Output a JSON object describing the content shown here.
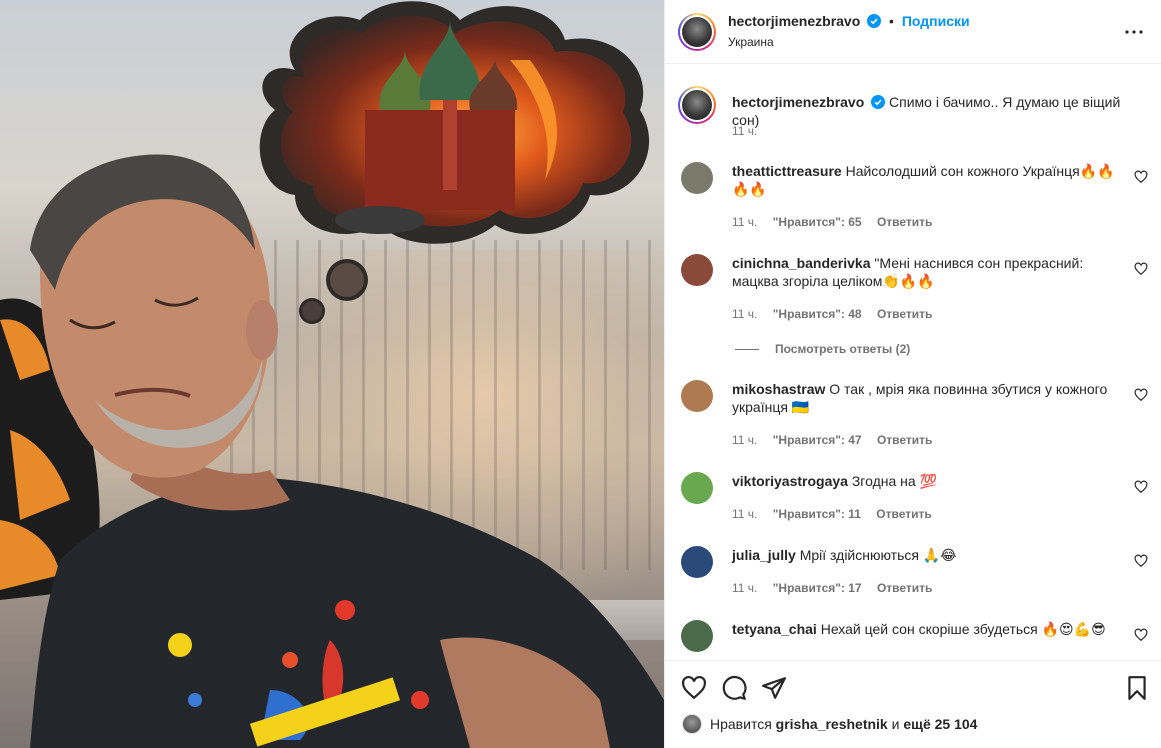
{
  "post": {
    "username": "hectorjimenezbravo",
    "separator": "•",
    "follow_label": "Подписки",
    "location": "Украина"
  },
  "caption": {
    "username": "hectorjimenezbravo",
    "text": "Спимо і бачимо.. Я думаю це віщий сон)",
    "time": "11 ч."
  },
  "comments": [
    {
      "username": "theatticttreasure",
      "text": "Найсолодший сон кожного Українця🔥🔥🔥🔥",
      "time": "11 ч.",
      "likes": "\"Нравится\": 65",
      "reply": "Ответить",
      "avatar_color": "#7a7a6a"
    },
    {
      "username": "cinichna_banderivka",
      "text": "\"Мені наснився сон прекрасний: мацква згоріла целіком👏🔥🔥",
      "time": "11 ч.",
      "likes": "\"Нравится\": 48",
      "reply": "Ответить",
      "avatar_color": "#8a4a3a",
      "view_replies": "Посмотреть ответы (2)"
    },
    {
      "username": "mikoshastraw",
      "text": "О так , мрія яка повинна збутися у кожного українця 🇺🇦",
      "time": "11 ч.",
      "likes": "\"Нравится\": 47",
      "reply": "Ответить",
      "avatar_color": "#b07a50"
    },
    {
      "username": "viktoriyastrogaya",
      "text": "Згодна на 💯",
      "time": "11 ч.",
      "likes": "\"Нравится\": 11",
      "reply": "Ответить",
      "avatar_color": "#6aa84f"
    },
    {
      "username": "julia_jully",
      "text": "Мрії здійснюються 🙏😂",
      "time": "11 ч.",
      "likes": "\"Нравится\": 17",
      "reply": "Ответить",
      "avatar_color": "#2a4a7a"
    },
    {
      "username": "tetyana_chai",
      "text": "Нехай цей сон скоріше збудеться 🔥😍💪😎",
      "avatar_color": "#4a6a4a"
    }
  ],
  "likes_bar": {
    "prefix": "Нравится",
    "user": "grisha_reshetnik",
    "middle": "и",
    "rest": "ещё 25 104"
  },
  "colors": {
    "accent": "#0095f6",
    "secondary_text": "#737373",
    "border": "#efefef"
  },
  "icons": [
    "more-icon",
    "verified-icon",
    "heart-icon",
    "comment-icon",
    "share-icon",
    "bookmark-icon"
  ]
}
